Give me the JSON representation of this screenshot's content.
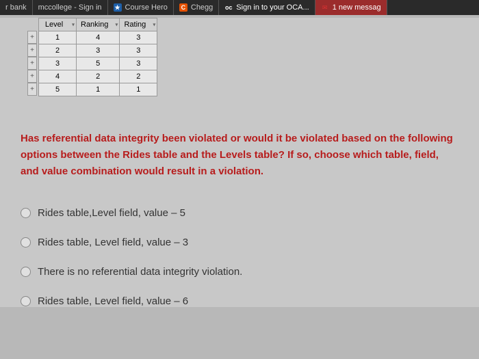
{
  "tabs": {
    "t0a": "r bank",
    "t0b": "mccollege - Sign in",
    "t1": "Course Hero",
    "t2": "Chegg",
    "t3": "Sign in to your OCA...",
    "t4": "1 new messag",
    "oc_label": "oc"
  },
  "table": {
    "headers": {
      "level": "Level",
      "ranking": "Ranking",
      "rating": "Rating"
    },
    "rows": [
      {
        "level": "1",
        "ranking": "4",
        "rating": "3"
      },
      {
        "level": "2",
        "ranking": "3",
        "rating": "3"
      },
      {
        "level": "3",
        "ranking": "5",
        "rating": "3"
      },
      {
        "level": "4",
        "ranking": "2",
        "rating": "2"
      },
      {
        "level": "5",
        "ranking": "1",
        "rating": "1"
      }
    ]
  },
  "question": "Has referential data integrity been violated or would it be violated based on the following options between the Rides table and the Levels table? If so, choose which table, field, and value combination would result in a violation.",
  "options": [
    "Rides table,Level field, value – 5",
    "Rides table, Level field, value – 3",
    "There is no referential data integrity violation.",
    "Rides table, Level field, value – 6"
  ]
}
